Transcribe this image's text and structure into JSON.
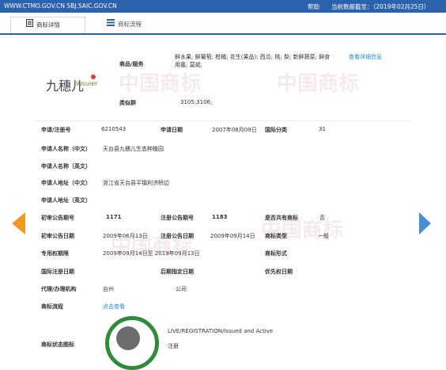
{
  "header": {
    "site": "WWW.CTMO.GOV.CN SBJ.SAIC.GOV.CN",
    "help": "帮助",
    "date": "当前数据截至：（2019年02月25日）"
  },
  "tabs": [
    {
      "label": "商标详情",
      "icon": "document-icon",
      "active": true
    },
    {
      "label": "商标流程",
      "icon": "list-icon",
      "active": false
    }
  ],
  "logo": {
    "cn": "九穗儿",
    "en": "Jiusuier"
  },
  "goods": {
    "label": "商品/服务",
    "value": "鲜水果; 鲜葡萄; 柑橘; 花生(果品); 西瓜; 桃; 梨; 新鲜蔬菜; 鲜食用菌; 莫斌;",
    "more": "查看详细信息"
  },
  "class_group": {
    "label": "类似群",
    "value": "3105;3106;"
  },
  "fields": {
    "reg_no_label": "申请/注册号",
    "reg_no": "6210543",
    "apply_date_label": "申请日期",
    "apply_date": "2007年08月09日",
    "intl_class_label": "国际分类",
    "intl_class": "31",
    "applicant_cn_label": "申请人名称（中文）",
    "applicant_cn": "天台县九穗儿生态种植园",
    "applicant_en_label": "申请人名称（英文）",
    "address_cn_label": "申请人地址（中文）",
    "address_cn": "浙江省天台县平镇利济桥边",
    "address_en_label": "申请人地址（英文）",
    "prelim_no_label": "初审公告期号",
    "prelim_no": "1171",
    "reg_notice_no_label": "注册公告期号",
    "reg_notice_no": "1183",
    "shared_label": "是否共有商标",
    "shared": "否",
    "prelim_date_label": "初审公告日期",
    "prelim_date": "2009年06月13日",
    "reg_notice_date_label": "注册公告日期",
    "reg_notice_date": "2009年09月14日",
    "type_label": "商标类型",
    "type": "一般",
    "exclusive_label": "专用权期限",
    "exclusive": "2009年09月14日至 2019年09月13日",
    "form_label": "商标形式",
    "intl_reg_date_label": "国际注册日期",
    "later_date_label": "后期指定日期",
    "priority_date_label": "优先权日期",
    "agent_label": "代理/办理机构",
    "agent_pre": "台州",
    "agent_post": "公司",
    "flow_label": "商标流程",
    "flow_link": "点击查看",
    "status_label": "商标状态图标",
    "status_text": "LIVE/REGISTRATION/Issued and Active",
    "status_cn": "注册"
  },
  "watermark": "中国商标",
  "colors": {
    "topbar": "#2b62ad",
    "link": "#1e88c7",
    "arrow_left": "#ee9a22",
    "arrow_right": "#4a8ed8",
    "seal": "#2d8b3a"
  }
}
